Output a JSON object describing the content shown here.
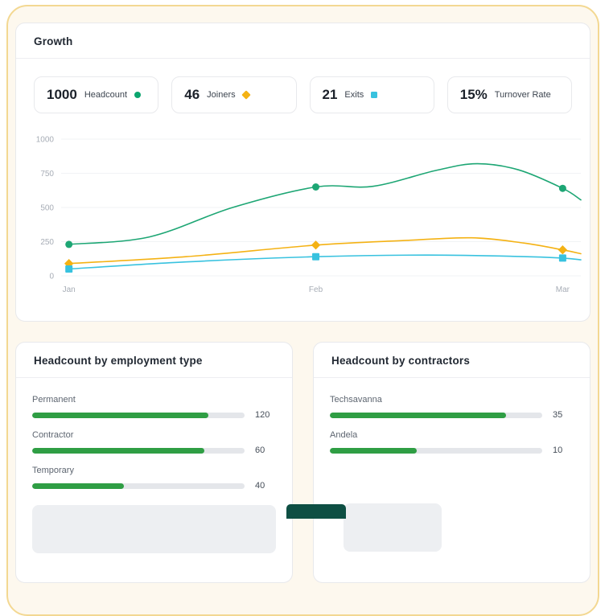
{
  "page": {
    "background": "#fdf8ee",
    "frame_border_color": "#f3d892"
  },
  "growth_card": {
    "title": "Growth",
    "stats": [
      {
        "value": "1000",
        "label": "Headcount",
        "marker": "circle",
        "color": "#0ba56e"
      },
      {
        "value": "46",
        "label": "Joiners",
        "marker": "diamond",
        "color": "#f4b214"
      },
      {
        "value": "21",
        "label": "Exits",
        "marker": "square",
        "color": "#38c2df"
      },
      {
        "value": "15%",
        "label": "Turnover Rate",
        "marker": "none",
        "color": ""
      }
    ]
  },
  "chart_data": {
    "type": "line",
    "title": "Growth",
    "x_ticks": [
      "Jan",
      "Feb",
      "Mar"
    ],
    "x_tick_pos": [
      0.015,
      0.49,
      0.965
    ],
    "y_ticks": [
      0,
      250,
      500,
      750,
      1000
    ],
    "ylim": [
      0,
      1000
    ],
    "grid": true,
    "legend_position": "none",
    "axis_color": "#a7adb6",
    "grid_color": "#f1f3f5",
    "series": [
      {
        "name": "Headcount",
        "color": "#1da674",
        "marker": "circle",
        "points": [
          [
            0.015,
            230
          ],
          [
            0.17,
            285
          ],
          [
            0.33,
            500
          ],
          [
            0.49,
            650
          ],
          [
            0.6,
            655
          ],
          [
            0.72,
            770
          ],
          [
            0.8,
            820
          ],
          [
            0.88,
            775
          ],
          [
            0.965,
            640
          ],
          [
            1.0,
            555
          ]
        ],
        "marker_points": [
          [
            0.015,
            230
          ],
          [
            0.49,
            650
          ],
          [
            0.965,
            640
          ]
        ],
        "marker_values": [
          230,
          650,
          640
        ]
      },
      {
        "name": "Joiners",
        "color": "#f4b214",
        "marker": "diamond",
        "points": [
          [
            0.015,
            90
          ],
          [
            0.24,
            140
          ],
          [
            0.49,
            225
          ],
          [
            0.66,
            258
          ],
          [
            0.79,
            278
          ],
          [
            0.89,
            240
          ],
          [
            0.965,
            190
          ],
          [
            1.0,
            162
          ]
        ],
        "marker_points": [
          [
            0.015,
            90
          ],
          [
            0.49,
            225
          ],
          [
            0.965,
            190
          ]
        ],
        "marker_values": [
          90,
          225,
          190
        ]
      },
      {
        "name": "Exits",
        "color": "#38c2df",
        "marker": "square",
        "points": [
          [
            0.015,
            50
          ],
          [
            0.24,
            102
          ],
          [
            0.49,
            140
          ],
          [
            0.7,
            152
          ],
          [
            0.88,
            142
          ],
          [
            0.965,
            130
          ],
          [
            1.0,
            117
          ]
        ],
        "marker_points": [
          [
            0.015,
            50
          ],
          [
            0.49,
            140
          ],
          [
            0.965,
            130
          ]
        ],
        "marker_values": [
          50,
          140,
          130
        ]
      }
    ]
  },
  "employment_card": {
    "title": "Headcount by employment type",
    "bar_color": "#2f9e44",
    "rows": [
      {
        "label": "Permanent",
        "value": "120",
        "pct": 83
      },
      {
        "label": "Contractor",
        "value": "60",
        "pct": 81
      },
      {
        "label": "Temporary",
        "value": "40",
        "pct": 43
      }
    ]
  },
  "contractors_card": {
    "title": "Headcount by contractors",
    "bar_color": "#2f9e44",
    "rows": [
      {
        "label": "Techsavanna",
        "value": "35",
        "pct": 83
      },
      {
        "label": "Andela",
        "value": "10",
        "pct": 41
      }
    ]
  }
}
